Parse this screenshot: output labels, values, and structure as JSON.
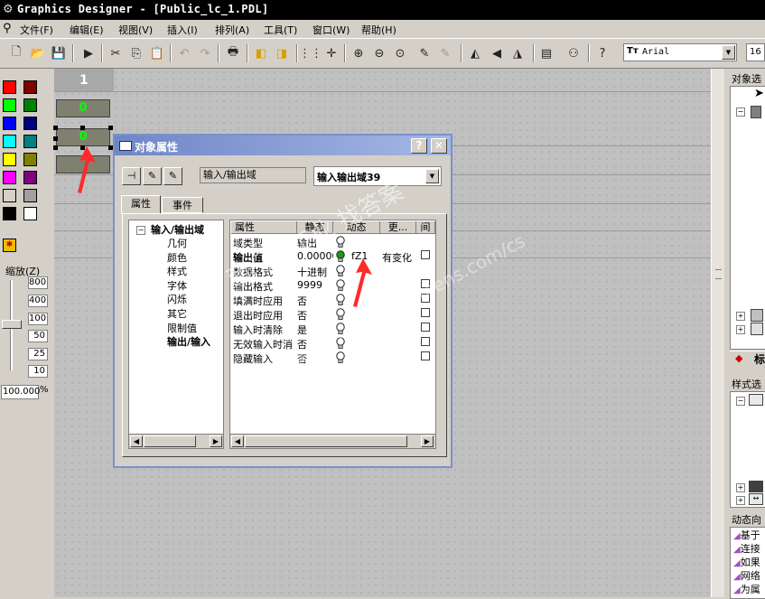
{
  "window": {
    "title": "Graphics Designer - [Public_lc_1.PDL]"
  },
  "menu": [
    "文件(F)",
    "编辑(E)",
    "视图(V)",
    "插入(I)",
    "排列(A)",
    "工具(T)",
    "窗口(W)",
    "帮助(H)"
  ],
  "toolbar": {
    "font_name": "Arial",
    "font_size": "16",
    "font_icon": "Tт"
  },
  "palette": {
    "colors": [
      "#ff0000",
      "#800000",
      "#00ff00",
      "#008000",
      "#0000ff",
      "#000080",
      "#00ffff",
      "#008080",
      "#ffff00",
      "#808000",
      "#ff00ff",
      "#800080",
      "#d4d0c8",
      "#a0a0a0",
      "#000000",
      "#ffffff"
    ]
  },
  "zoom": {
    "label": "缩放(Z)",
    "ticks": [
      "800",
      "400",
      "100",
      "50",
      "25",
      "10"
    ],
    "value": "100.000",
    "percent": "%"
  },
  "canvas": {
    "ruler_number": "1",
    "fields": [
      "0",
      "0",
      ""
    ]
  },
  "right_panel": {
    "object_selector_label": "对象选",
    "style_selector_label": "样式选",
    "dynamic_label": "动态向",
    "standard_label": "标",
    "dyn_items": [
      "基于",
      "连接",
      "如果",
      "网络",
      "为属"
    ]
  },
  "dialog": {
    "title": "对象属性",
    "help": "?",
    "close": "✕",
    "type_label": "输入/输出域",
    "object_name": "输入输出域39",
    "tabs": {
      "properties": "属性",
      "events": "事件"
    },
    "tree": {
      "root": "输入/输出域",
      "items": [
        "几何",
        "颜色",
        "样式",
        "字体",
        "闪烁",
        "其它",
        "限制值",
        "输出/输入"
      ]
    },
    "grid": {
      "headers": {
        "attribute": "属性",
        "static": "静态",
        "dynamic": "动态",
        "update": "更...",
        "indirect": "间"
      },
      "rows": [
        {
          "attribute": "域类型",
          "static": "输出",
          "dynamic": "",
          "update": "",
          "bold": false,
          "active": false,
          "check": false
        },
        {
          "attribute": "输出值",
          "static": "0.00000",
          "dynamic": "fZ1",
          "update": "有变化",
          "bold": true,
          "active": true,
          "check": true
        },
        {
          "attribute": "数据格式",
          "static": "十进制",
          "dynamic": "",
          "update": "",
          "bold": false,
          "active": false,
          "check": false
        },
        {
          "attribute": "输出格式",
          "static": "9999",
          "dynamic": "",
          "update": "",
          "bold": false,
          "active": false,
          "check": true
        },
        {
          "attribute": "填满时应用",
          "static": "否",
          "dynamic": "",
          "update": "",
          "bold": false,
          "active": false,
          "check": true
        },
        {
          "attribute": "退出时应用",
          "static": "否",
          "dynamic": "",
          "update": "",
          "bold": false,
          "active": false,
          "check": true
        },
        {
          "attribute": "输入时清除",
          "static": "是",
          "dynamic": "",
          "update": "",
          "bold": false,
          "active": false,
          "check": true
        },
        {
          "attribute": "无效输入时消",
          "static": "否",
          "dynamic": "",
          "update": "",
          "bold": false,
          "active": false,
          "check": true
        },
        {
          "attribute": "隐藏输入",
          "static": "否",
          "dynamic": "",
          "update": "",
          "bold": false,
          "active": false,
          "check": true
        }
      ]
    }
  },
  "watermark": {
    "line1": "西门子工业 找答案",
    "line2": "support.industry.siemens.com/cs"
  }
}
